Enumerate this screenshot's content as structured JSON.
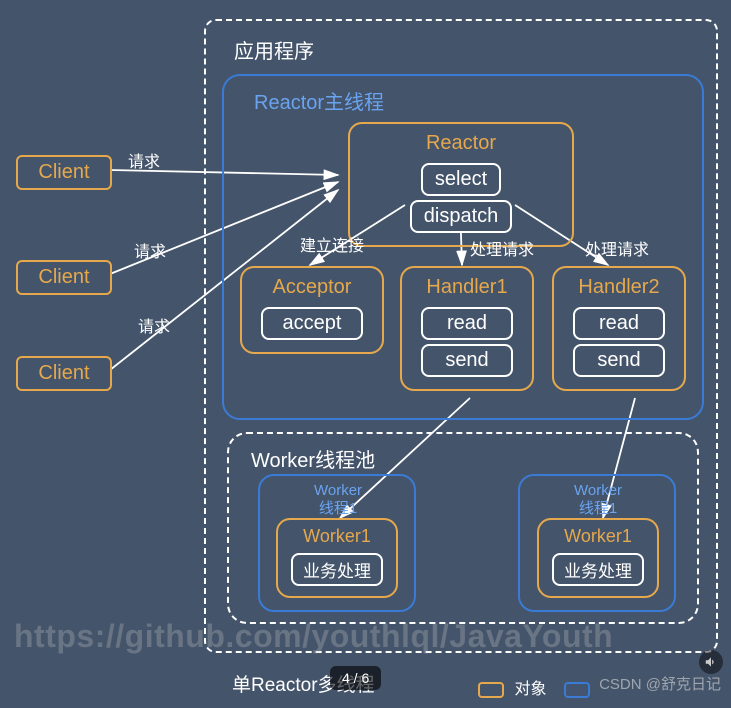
{
  "app_box": {
    "title": "应用程序"
  },
  "main_thread": {
    "title": "Reactor主线程"
  },
  "clients": [
    "Client",
    "Client",
    "Client"
  ],
  "request_labels": [
    "请求",
    "请求",
    "请求"
  ],
  "reactor": {
    "title": "Reactor",
    "actions": [
      "select",
      "dispatch"
    ]
  },
  "edges": {
    "establish": "建立连接",
    "handle1": "处理请求",
    "handle2": "处理请求"
  },
  "acceptor": {
    "title": "Acceptor",
    "actions": [
      "accept"
    ]
  },
  "handler1": {
    "title": "Handler1",
    "actions": [
      "read",
      "send"
    ]
  },
  "handler2": {
    "title": "Handler2",
    "actions": [
      "read",
      "send"
    ]
  },
  "worker_pool": {
    "title": "Worker线程池"
  },
  "worker_thread1": {
    "title_l1": "Worker",
    "title_l2": "线程1"
  },
  "worker_thread2": {
    "title_l1": "Worker",
    "title_l2": "线程1"
  },
  "worker1": {
    "title": "Worker1",
    "action": "业务处理"
  },
  "worker2": {
    "title": "Worker1",
    "action": "业务处理"
  },
  "caption": "单Reactor多线程",
  "legend": {
    "object": "对象",
    "unknown": ""
  },
  "page_indicator": "4 / 6",
  "watermark_github": "https://github.com/youthlql/JavaYouth",
  "watermark_csdn": "CSDN @舒克日记"
}
